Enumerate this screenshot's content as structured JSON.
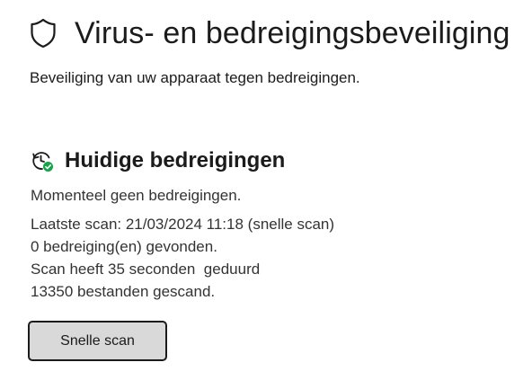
{
  "header": {
    "icon": "shield-icon",
    "title": "Virus- en bedreigingsbeveiliging",
    "subtitle": "Beveiliging van uw apparaat tegen bedreigingen."
  },
  "current_threats": {
    "icon": "history-check-icon",
    "title": "Huidige bedreigingen",
    "status": "Momenteel geen bedreigingen.",
    "details": {
      "last_scan": "Laatste scan: 21/03/2024 11:18 (snelle scan)",
      "threats_found": "0 bedreiging(en) gevonden.",
      "duration": "Scan heeft 35 seconden  geduurd",
      "files_scanned": "13350 bestanden gescand."
    },
    "quick_scan_label": "Snelle scan"
  },
  "colors": {
    "text": "#1b1b1b",
    "secondary_text": "#333333",
    "button_background": "#d9d9d9",
    "status_ok": "#16a34a"
  }
}
